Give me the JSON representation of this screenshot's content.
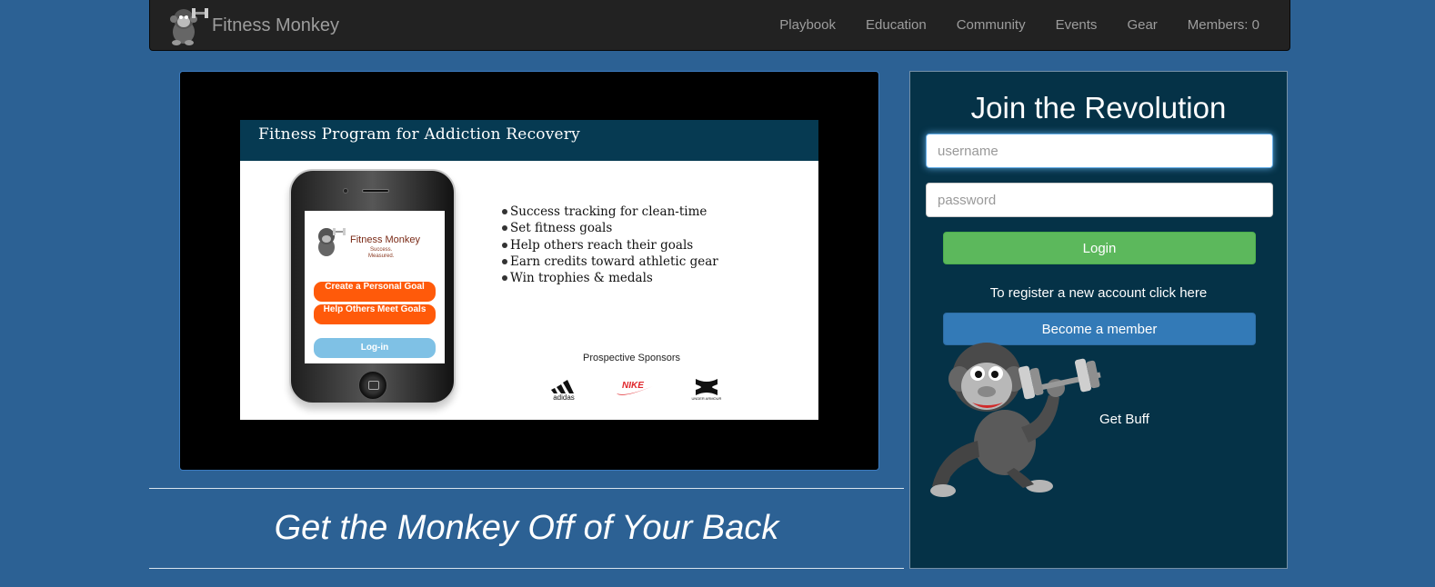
{
  "navbar": {
    "brand": "Fitness Monkey",
    "logo_icon": "monkey-logo-icon",
    "links": [
      "Playbook",
      "Education",
      "Community",
      "Events",
      "Gear",
      "Members: 0"
    ]
  },
  "slide": {
    "title": "Fitness Program for Addiction Recovery",
    "phone": {
      "app_name": "Fitness Monkey",
      "tagline_1": "Success.",
      "tagline_2": "Measured.",
      "buttons": [
        "Create a Personal Goal",
        "Help Others Meet Goals",
        "Log-in"
      ]
    },
    "bullets": [
      "Success tracking for clean-time",
      "Set fitness goals",
      "Help others reach their goals",
      "Earn credits toward athletic gear",
      "Win trophies & medals"
    ],
    "sponsors_title": "Prospective Sponsors",
    "sponsors": [
      "adidas",
      "NIKE",
      "UNDER ARMOUR"
    ]
  },
  "tagline": "Get the Monkey Off of Your Back",
  "login": {
    "title": "Join the Revolution",
    "username_placeholder": "username",
    "password_placeholder": "password",
    "login_label": "Login",
    "register_text": "To register a new account click here",
    "member_label": "Become a member",
    "caption": "Get Buff"
  },
  "colors": {
    "page_bg": "#2c6194",
    "navbar_bg": "#222222",
    "panel_bg": "#053247",
    "login_green": "#5cb85c",
    "member_blue": "#337ab7"
  }
}
